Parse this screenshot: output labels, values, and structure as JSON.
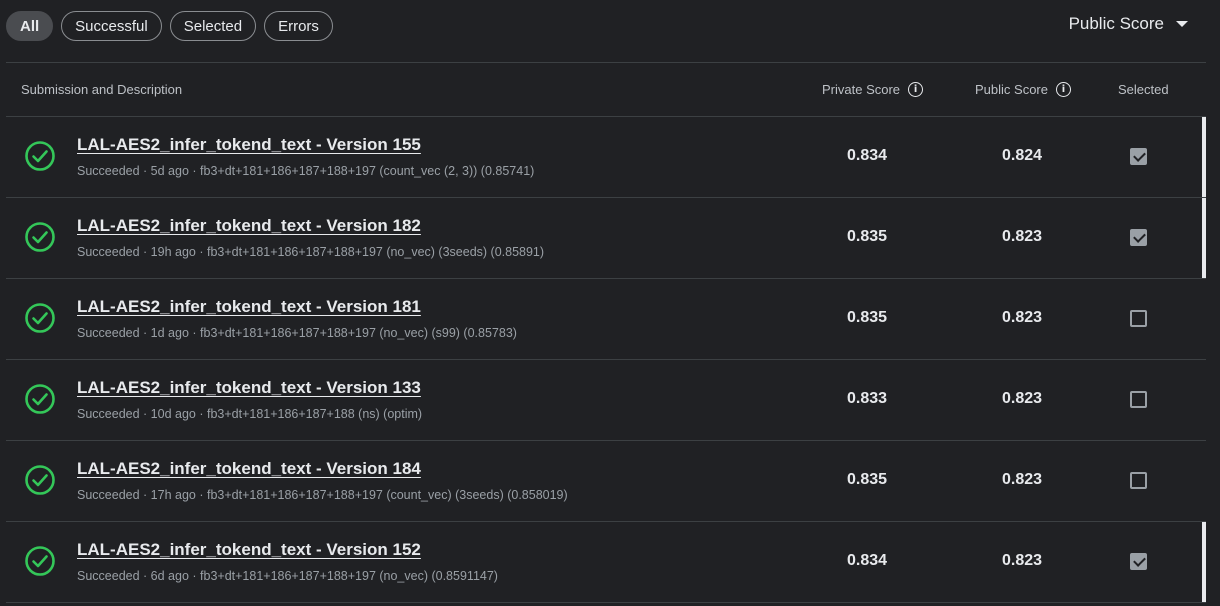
{
  "filters": [
    "All",
    "Successful",
    "Selected",
    "Errors"
  ],
  "sort_label": "Public Score",
  "headers": {
    "submission": "Submission and Description",
    "private": "Private Score",
    "public": "Public Score",
    "selected": "Selected"
  },
  "rows": [
    {
      "title": "LAL-AES2_infer_tokend_text - Version 155",
      "status": "Succeeded",
      "age": "5d ago",
      "desc": "fb3+dt+181+186+187+188+197 (count_vec (2, 3)) (0.85741)",
      "private": "0.834",
      "public": "0.824",
      "selected": true
    },
    {
      "title": "LAL-AES2_infer_tokend_text - Version 182",
      "status": "Succeeded",
      "age": "19h ago",
      "desc": "fb3+dt+181+186+187+188+197 (no_vec) (3seeds) (0.85891)",
      "private": "0.835",
      "public": "0.823",
      "selected": true
    },
    {
      "title": "LAL-AES2_infer_tokend_text - Version 181",
      "status": "Succeeded",
      "age": "1d ago",
      "desc": "fb3+dt+181+186+187+188+197 (no_vec) (s99) (0.85783)",
      "private": "0.835",
      "public": "0.823",
      "selected": false
    },
    {
      "title": "LAL-AES2_infer_tokend_text - Version 133",
      "status": "Succeeded",
      "age": "10d ago",
      "desc": "fb3+dt+181+186+187+188 (ns) (optim)",
      "private": "0.833",
      "public": "0.823",
      "selected": false
    },
    {
      "title": "LAL-AES2_infer_tokend_text - Version 184",
      "status": "Succeeded",
      "age": "17h ago",
      "desc": "fb3+dt+181+186+187+188+197 (count_vec) (3seeds) (0.858019)",
      "private": "0.835",
      "public": "0.823",
      "selected": false
    },
    {
      "title": "LAL-AES2_infer_tokend_text - Version 152",
      "status": "Succeeded",
      "age": "6d ago",
      "desc": "fb3+dt+181+186+187+188+197 (no_vec) (0.8591147)",
      "private": "0.834",
      "public": "0.823",
      "selected": true
    }
  ],
  "colors": {
    "success": "#34c759",
    "background": "#202124"
  },
  "icons": {
    "status": "check-circle-icon",
    "info": "info-icon",
    "sort": "caret-down-icon"
  }
}
